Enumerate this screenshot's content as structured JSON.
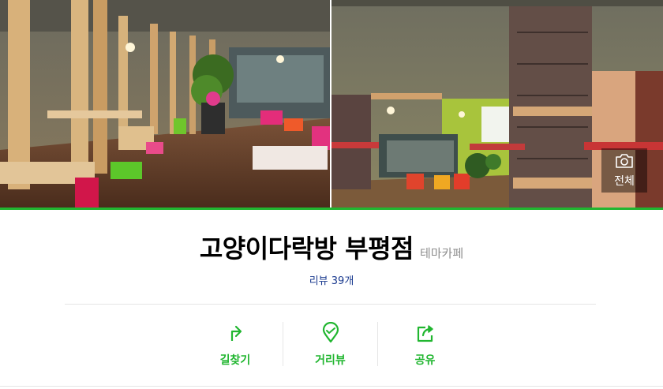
{
  "place": {
    "name": "고양이다락방 부평점",
    "category": "테마카페",
    "review_label": "리뷰 39개"
  },
  "photos": {
    "view_all_label": "전체",
    "view_all_icon": "camera-icon"
  },
  "actions": [
    {
      "label": "길찾기",
      "icon": "directions-icon"
    },
    {
      "label": "거리뷰",
      "icon": "street-view-pin-icon"
    },
    {
      "label": "공유",
      "icon": "share-icon"
    }
  ],
  "colors": {
    "accent": "#21b630",
    "review_link": "#1a3a8f",
    "category_text": "#8e8e8e"
  }
}
